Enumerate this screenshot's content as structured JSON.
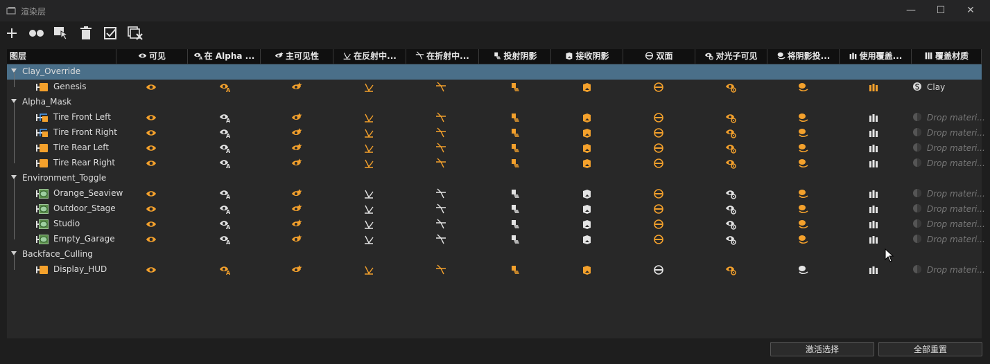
{
  "window": {
    "title": "渲染层",
    "minimize": "—",
    "maximize": "☐",
    "close": "✕"
  },
  "toolbar": [
    {
      "name": "add-layer-button",
      "icon": "plus-icon"
    },
    {
      "name": "merge-layers-button",
      "icon": "two-dots-icon"
    },
    {
      "name": "select-objects-button",
      "icon": "select-cursor-icon"
    },
    {
      "name": "delete-layer-button",
      "icon": "trash-icon"
    },
    {
      "name": "activate-check-button",
      "icon": "checkbox-icon"
    },
    {
      "name": "remove-override-button",
      "icon": "stack-x-icon"
    }
  ],
  "columns": [
    "图层",
    "可见",
    "在 Alpha ...",
    "主可见性",
    "在反射中...",
    "在折射中...",
    "投射阴影",
    "接收阴影",
    "双面",
    "对光子可见",
    "将阴影投...",
    "使用覆盖...",
    "覆盖材质"
  ],
  "colors": {
    "accent": "#f4a12c",
    "white_icon": "#e4e4e4",
    "selected_row": "#4a6f89",
    "drop_text": "#777777"
  },
  "groups": [
    {
      "name": "Clay_Override",
      "selected": true,
      "children": [
        {
          "name": "Genesis",
          "type": "solid",
          "cols": [
            "o",
            "o",
            "o",
            "o",
            "o",
            "o",
            "o",
            "o",
            "o",
            "o",
            "o"
          ],
          "material": "Clay",
          "material_drop": false
        }
      ]
    },
    {
      "name": "Alpha_Mask",
      "children": [
        {
          "name": "Tire Front Left",
          "type": "curve",
          "cols": [
            "o",
            "w",
            "o",
            "o",
            "o",
            "o",
            "o",
            "o",
            "o",
            "o",
            "w"
          ],
          "material": "Drop materi...",
          "material_drop": true
        },
        {
          "name": "Tire Front Right",
          "type": "curve",
          "cols": [
            "o",
            "w",
            "o",
            "o",
            "o",
            "o",
            "o",
            "o",
            "o",
            "o",
            "w"
          ],
          "material": "Drop materi...",
          "material_drop": true
        },
        {
          "name": "Tire Rear Left",
          "type": "solid",
          "cols": [
            "o",
            "w",
            "o",
            "o",
            "o",
            "o",
            "o",
            "o",
            "o",
            "o",
            "w"
          ],
          "material": "Drop materi...",
          "material_drop": true
        },
        {
          "name": "Tire Rear Right",
          "type": "solid",
          "cols": [
            "o",
            "w",
            "o",
            "o",
            "o",
            "o",
            "o",
            "o",
            "o",
            "o",
            "w"
          ],
          "material": "Drop materi...",
          "material_drop": true
        }
      ]
    },
    {
      "name": "Environment_Toggle",
      "children": [
        {
          "name": "Orange_Seaview",
          "type": "env",
          "cols": [
            "o",
            "w",
            "o",
            "w",
            "w",
            "w",
            "w",
            "o",
            "w",
            "o",
            "w"
          ],
          "material": "Drop materi...",
          "material_drop": true
        },
        {
          "name": "Outdoor_Stage",
          "type": "env",
          "cols": [
            "o",
            "w",
            "o",
            "w",
            "w",
            "w",
            "w",
            "o",
            "w",
            "o",
            "w"
          ],
          "material": "Drop materi...",
          "material_drop": true
        },
        {
          "name": "Studio",
          "type": "env",
          "cols": [
            "o",
            "w",
            "o",
            "w",
            "w",
            "w",
            "w",
            "o",
            "w",
            "o",
            "w"
          ],
          "material": "Drop materi...",
          "material_drop": true
        },
        {
          "name": "Empty_Garage",
          "type": "env",
          "cols": [
            "o",
            "w",
            "o",
            "w",
            "w",
            "w",
            "w",
            "o",
            "w",
            "o",
            "w"
          ],
          "material": "Drop materi...",
          "material_drop": true
        }
      ]
    },
    {
      "name": "Backface_Culling",
      "children": [
        {
          "name": "Display_HUD",
          "type": "solid",
          "cols": [
            "o",
            "o",
            "o",
            "o",
            "o",
            "o",
            "o",
            "w",
            "o",
            "w",
            "w"
          ],
          "material": "Drop materi...",
          "material_drop": true
        }
      ]
    }
  ],
  "footer": {
    "activate_selection": "激活选择",
    "reset_all": "全部重置"
  }
}
